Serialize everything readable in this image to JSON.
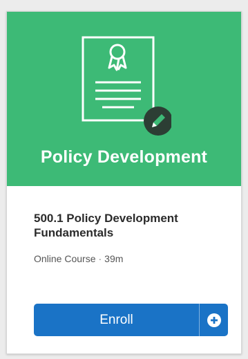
{
  "card": {
    "banner_title": "Policy Development",
    "banner_color": "#3dba76",
    "illustration_icon": "certificate-document-with-pencil-icon",
    "course_title": "500.1 Policy Development Fundamentals",
    "course_type": "Online Course",
    "meta_separator": "·",
    "duration": "39m",
    "enroll_label": "Enroll",
    "enroll_color": "#1a73c6",
    "add_icon": "plus-circle-icon"
  }
}
